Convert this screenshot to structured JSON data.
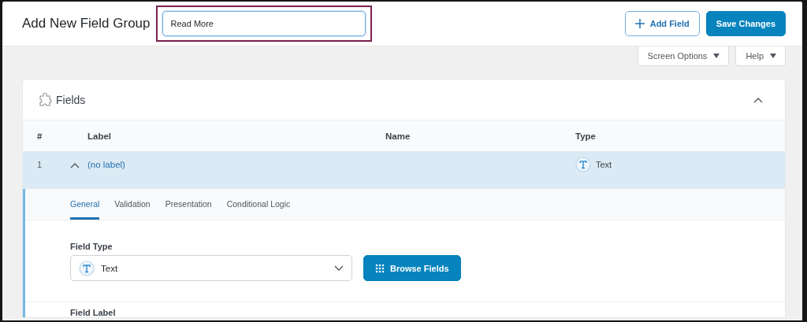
{
  "header": {
    "title": "Add New Field Group",
    "title_field": {
      "value": "Read More",
      "highlighted": true
    },
    "buttons": [
      {
        "label": "Add Field",
        "kind": "secondary"
      },
      {
        "label": "Save Changes",
        "kind": "primary"
      }
    ]
  },
  "screen_meta": [
    {
      "label": "Screen Options"
    },
    {
      "label": "Help"
    }
  ],
  "panel": {
    "title": "Fields",
    "expanded": true,
    "table": {
      "columns": [
        "#",
        "Label",
        "Name",
        "Type"
      ],
      "rows": [
        {
          "number": "1",
          "label": "(no label)",
          "type": "Text",
          "expanded": true,
          "selected": true
        }
      ]
    },
    "field_tabs": [
      {
        "label": "General",
        "selected": true
      },
      {
        "label": "Validation",
        "selected": false
      },
      {
        "label": "Presentation",
        "selected": false
      },
      {
        "label": "Conditional Logic",
        "selected": false
      }
    ],
    "field_type": {
      "label": "Field Type",
      "value": "Text"
    },
    "browse_button": "Browse Fields",
    "next_label": "Field Label"
  }
}
